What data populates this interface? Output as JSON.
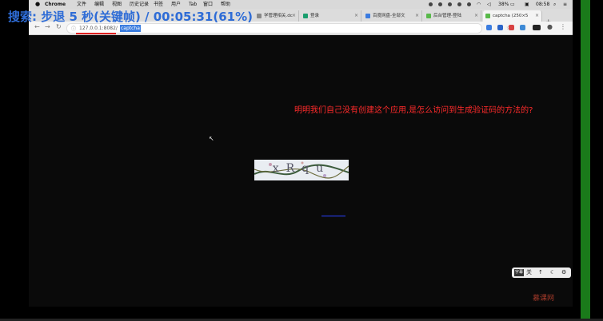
{
  "menubar": {
    "apple": "",
    "app": "Chrome",
    "items": [
      "文件",
      "编辑",
      "视图",
      "历史记录",
      "书签",
      "用户",
      "Tab",
      "窗口",
      "帮助"
    ],
    "battery": "38%",
    "clock": "08:58"
  },
  "overlay": {
    "text": "搜索: 步退 5 秒(关键帧) / 00:05:31(61%)"
  },
  "tabs": [
    {
      "label": "学管理相关.dc",
      "color": "#888888"
    },
    {
      "label": "登录",
      "color": "#1a9e6e"
    },
    {
      "label": "百度网盘-全部文",
      "color": "#3a7be0"
    },
    {
      "label": "后台管理-登陆",
      "color": "#58b94a"
    },
    {
      "label": "captcha (250×5",
      "color": "#58b94a"
    }
  ],
  "address": {
    "host": "127.0.0.1:8082/",
    "path": "captcha"
  },
  "page": {
    "question": "明明我们自己没有创建这个应用,是怎么访问到生成验证码的方法的?",
    "captcha_text": "xRqu",
    "link": "____________"
  },
  "controls": {
    "items": [
      "字幕",
      "关",
      "↑",
      "☾",
      "⚙"
    ]
  },
  "watermark": "慕课网",
  "colors": {
    "green_bar": "#1a7a1a",
    "question": "#ff2b2b"
  }
}
